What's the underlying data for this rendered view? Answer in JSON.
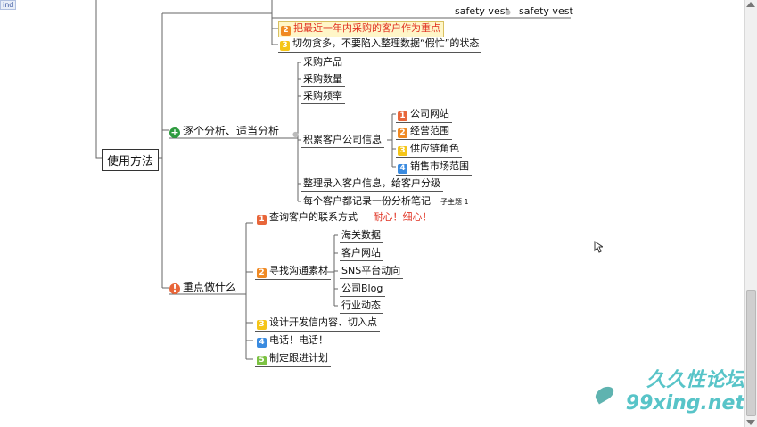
{
  "window": {
    "tab_fragment": "ind"
  },
  "top": {
    "item1": "safety vest",
    "item2": "safety vest"
  },
  "colors": {
    "badge1": "#e8663a",
    "badge2": "#f08a24",
    "badge3": "#f5c518",
    "badge4": "#3a8be0",
    "badge5": "#7cc242",
    "plus_icon": "#2e9b3f",
    "bang_icon": "#e8663a",
    "red_text": "#e03020"
  },
  "mindmap": {
    "root": "使用方法",
    "top_items": [
      {
        "badge": "2",
        "text": "把最近一年内采购的客户作为重点"
      },
      {
        "badge": "3",
        "text": "切勿贪多，不要陷入整理数据“假忙”的状态"
      }
    ],
    "branch1": {
      "title": "逐个分析、适当分析",
      "icon": "plus",
      "children": [
        "采购产品",
        "采购数量",
        "采购频率"
      ],
      "info_node": {
        "title": "积累客户公司信息",
        "items": [
          {
            "badge": "1",
            "text": "公司网站"
          },
          {
            "badge": "2",
            "text": "经营范围"
          },
          {
            "badge": "3",
            "text": "供应链角色"
          },
          {
            "badge": "4",
            "text": "销售市场范围"
          }
        ]
      },
      "tail": [
        "整理录入客户信息，给客户分级",
        "每个客户都记录一份分析笔记"
      ],
      "sub_topic": "子主题 1"
    },
    "branch2": {
      "title": "重点做什么",
      "icon": "bang",
      "item1": {
        "badge": "1",
        "text": "查询客户的联系方式",
        "note": "耐心！细心！"
      },
      "item2": {
        "badge": "2",
        "text": "寻找沟通素材",
        "children": [
          "海关数据",
          "客户网站",
          "SNS平台动向",
          "公司Blog",
          "行业动态"
        ]
      },
      "item3": {
        "badge": "3",
        "text": "设计开发信内容、切入点"
      },
      "item4": {
        "badge": "4",
        "text": "电话！电话！"
      },
      "item5": {
        "badge": "5",
        "text": "制定跟进计划"
      }
    }
  },
  "watermark": {
    "line1": "久久性论坛",
    "line2": "99xing.net"
  }
}
